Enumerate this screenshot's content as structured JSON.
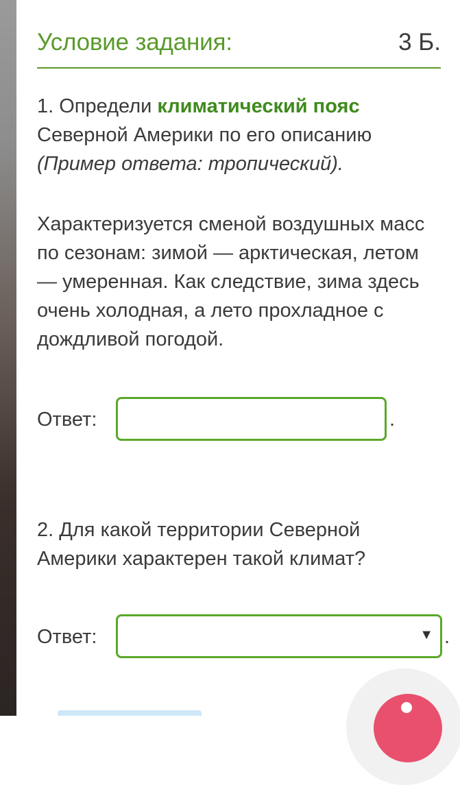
{
  "header": {
    "title": "Условие задания:",
    "score": "3 Б."
  },
  "question1": {
    "prefix": "1. Определи ",
    "highlight": "климатический пояс",
    "suffix": " Северной Америки по его описанию",
    "example": "(Пример ответа: тропический)."
  },
  "description": "Характеризуется сменой воздушных масс по сезонам: зимой — арктическая, летом — умеренная. Как следствие, зима здесь очень холодная, а лето прохладное с дождливой погодой.",
  "answer1": {
    "label": "Ответ:",
    "value": "",
    "trailing": "."
  },
  "question2": {
    "text": "2. Для какой территории Северной Америки характерен такой климат?"
  },
  "answer2": {
    "label": "Ответ:",
    "selected": "",
    "arrow": "▼",
    "trailing": "."
  },
  "colors": {
    "accent": "#5a9a2a",
    "highlight": "#3f8a1d",
    "fab": "#e8506e"
  }
}
